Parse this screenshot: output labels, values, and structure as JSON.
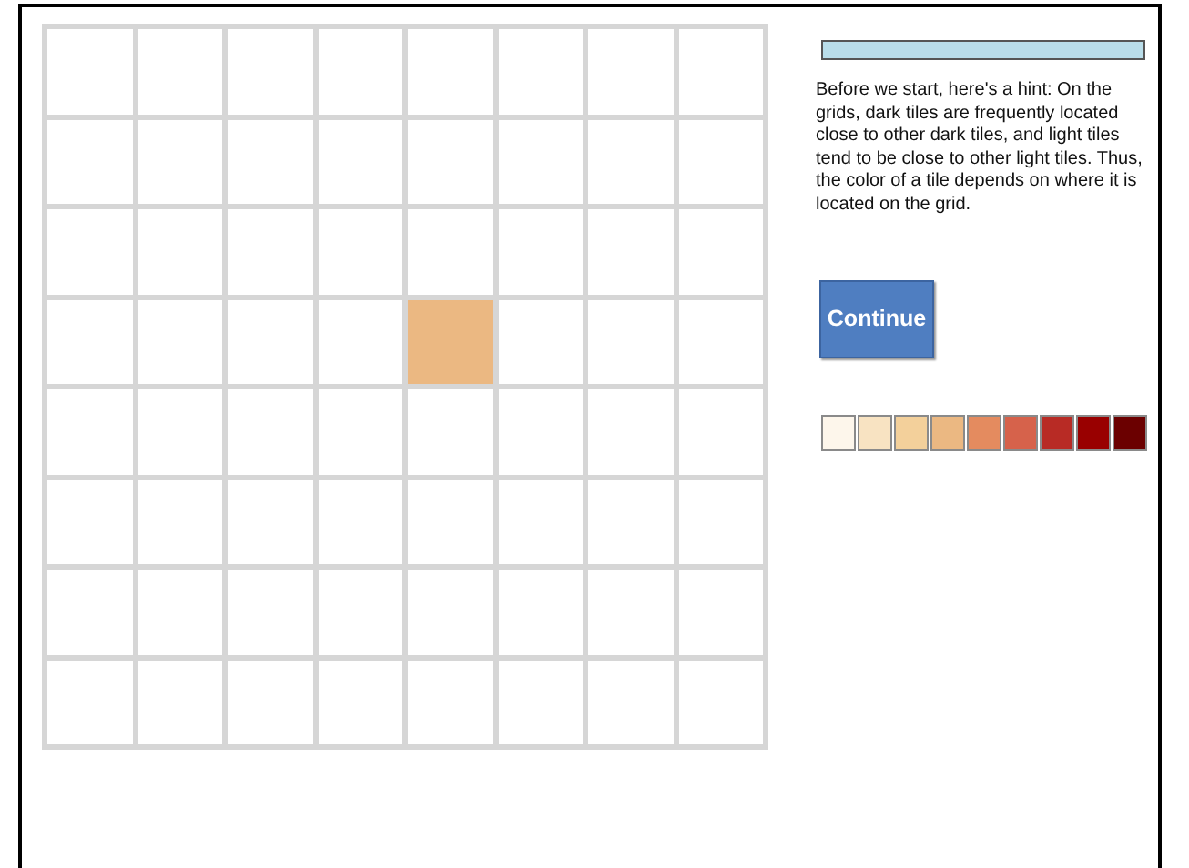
{
  "grid": {
    "tiles": [
      {
        "color": "#ffffff"
      },
      {
        "color": "#ffffff"
      },
      {
        "color": "#ffffff"
      },
      {
        "color": "#ffffff"
      },
      {
        "color": "#ffffff"
      },
      {
        "color": "#ffffff"
      },
      {
        "color": "#ffffff"
      },
      {
        "color": "#ffffff"
      },
      {
        "color": "#ffffff"
      },
      {
        "color": "#ffffff"
      },
      {
        "color": "#ffffff"
      },
      {
        "color": "#ffffff"
      },
      {
        "color": "#ffffff"
      },
      {
        "color": "#ffffff"
      },
      {
        "color": "#ffffff"
      },
      {
        "color": "#ffffff"
      },
      {
        "color": "#ffffff"
      },
      {
        "color": "#ffffff"
      },
      {
        "color": "#ffffff"
      },
      {
        "color": "#ffffff"
      },
      {
        "color": "#ffffff"
      },
      {
        "color": "#ffffff"
      },
      {
        "color": "#ffffff"
      },
      {
        "color": "#ffffff"
      },
      {
        "color": "#ffffff"
      },
      {
        "color": "#ffffff"
      },
      {
        "color": "#ffffff"
      },
      {
        "color": "#ffffff"
      },
      {
        "color": "#ebb882"
      },
      {
        "color": "#ffffff"
      },
      {
        "color": "#ffffff"
      },
      {
        "color": "#ffffff"
      },
      {
        "color": "#ffffff"
      },
      {
        "color": "#ffffff"
      },
      {
        "color": "#ffffff"
      },
      {
        "color": "#ffffff"
      },
      {
        "color": "#ffffff"
      },
      {
        "color": "#ffffff"
      },
      {
        "color": "#ffffff"
      },
      {
        "color": "#ffffff"
      },
      {
        "color": "#ffffff"
      },
      {
        "color": "#ffffff"
      },
      {
        "color": "#ffffff"
      },
      {
        "color": "#ffffff"
      },
      {
        "color": "#ffffff"
      },
      {
        "color": "#ffffff"
      },
      {
        "color": "#ffffff"
      },
      {
        "color": "#ffffff"
      },
      {
        "color": "#ffffff"
      },
      {
        "color": "#ffffff"
      },
      {
        "color": "#ffffff"
      },
      {
        "color": "#ffffff"
      },
      {
        "color": "#ffffff"
      },
      {
        "color": "#ffffff"
      },
      {
        "color": "#ffffff"
      },
      {
        "color": "#ffffff"
      },
      {
        "color": "#ffffff"
      },
      {
        "color": "#ffffff"
      },
      {
        "color": "#ffffff"
      },
      {
        "color": "#ffffff"
      },
      {
        "color": "#ffffff"
      },
      {
        "color": "#ffffff"
      },
      {
        "color": "#ffffff"
      },
      {
        "color": "#ffffff"
      }
    ]
  },
  "progress": {
    "level": 1
  },
  "hint": "Before we start, here's a hint: On the grids, dark tiles are frequently located close to other dark tiles, and light tiles tend to be close to other light tiles. Thus, the color of a tile depends on where it is located on the grid.",
  "continue_button": "Continue",
  "palette": [
    {
      "color": "#fdf6eb"
    },
    {
      "color": "#f8e3c2"
    },
    {
      "color": "#f3d09b"
    },
    {
      "color": "#ebb882"
    },
    {
      "color": "#e48b5f"
    },
    {
      "color": "#d6624b"
    },
    {
      "color": "#b82b25"
    },
    {
      "color": "#990000"
    },
    {
      "color": "#6b0000"
    }
  ]
}
